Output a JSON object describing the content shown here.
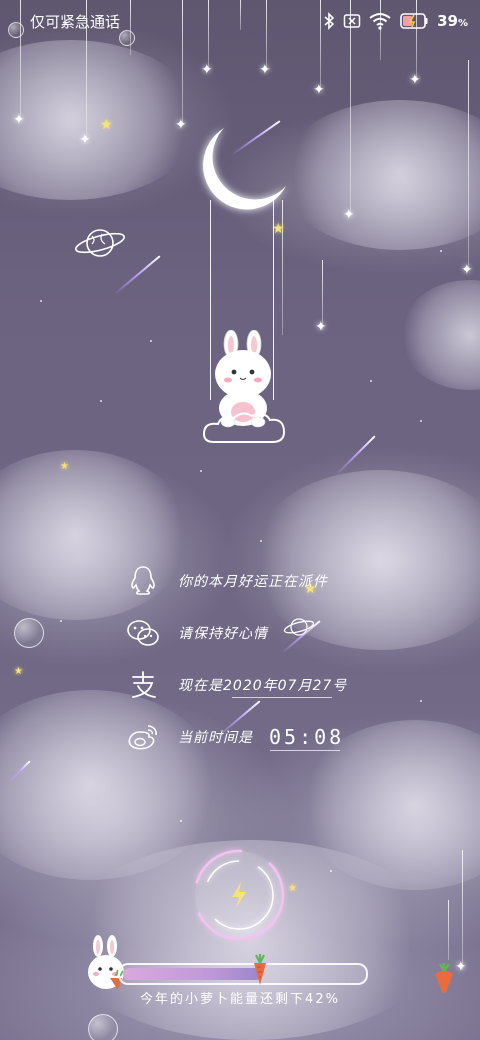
{
  "status_bar": {
    "carrier": "仅可紧急通话",
    "battery_percent": "39",
    "battery_percent_sign": "%"
  },
  "info_rows": [
    {
      "icon": "qq-penguin-icon",
      "text": "你的本月好运正在派件"
    },
    {
      "icon": "wechat-icon",
      "text": "请保持好心情"
    },
    {
      "icon": "alipay-icon",
      "text": "现在是2020年07月27号"
    },
    {
      "icon": "weibo-icon",
      "text": "当前时间是",
      "time": "05:08"
    }
  ],
  "charging": {
    "icon": "lightning-icon"
  },
  "progress": {
    "fraction": 0.58,
    "caption": "今年的小萝卜能量还剩下42%"
  },
  "colors": {
    "sky": "#6c6380",
    "accent_purple": "#b89be0",
    "progress_fill": "#c09ad8"
  }
}
